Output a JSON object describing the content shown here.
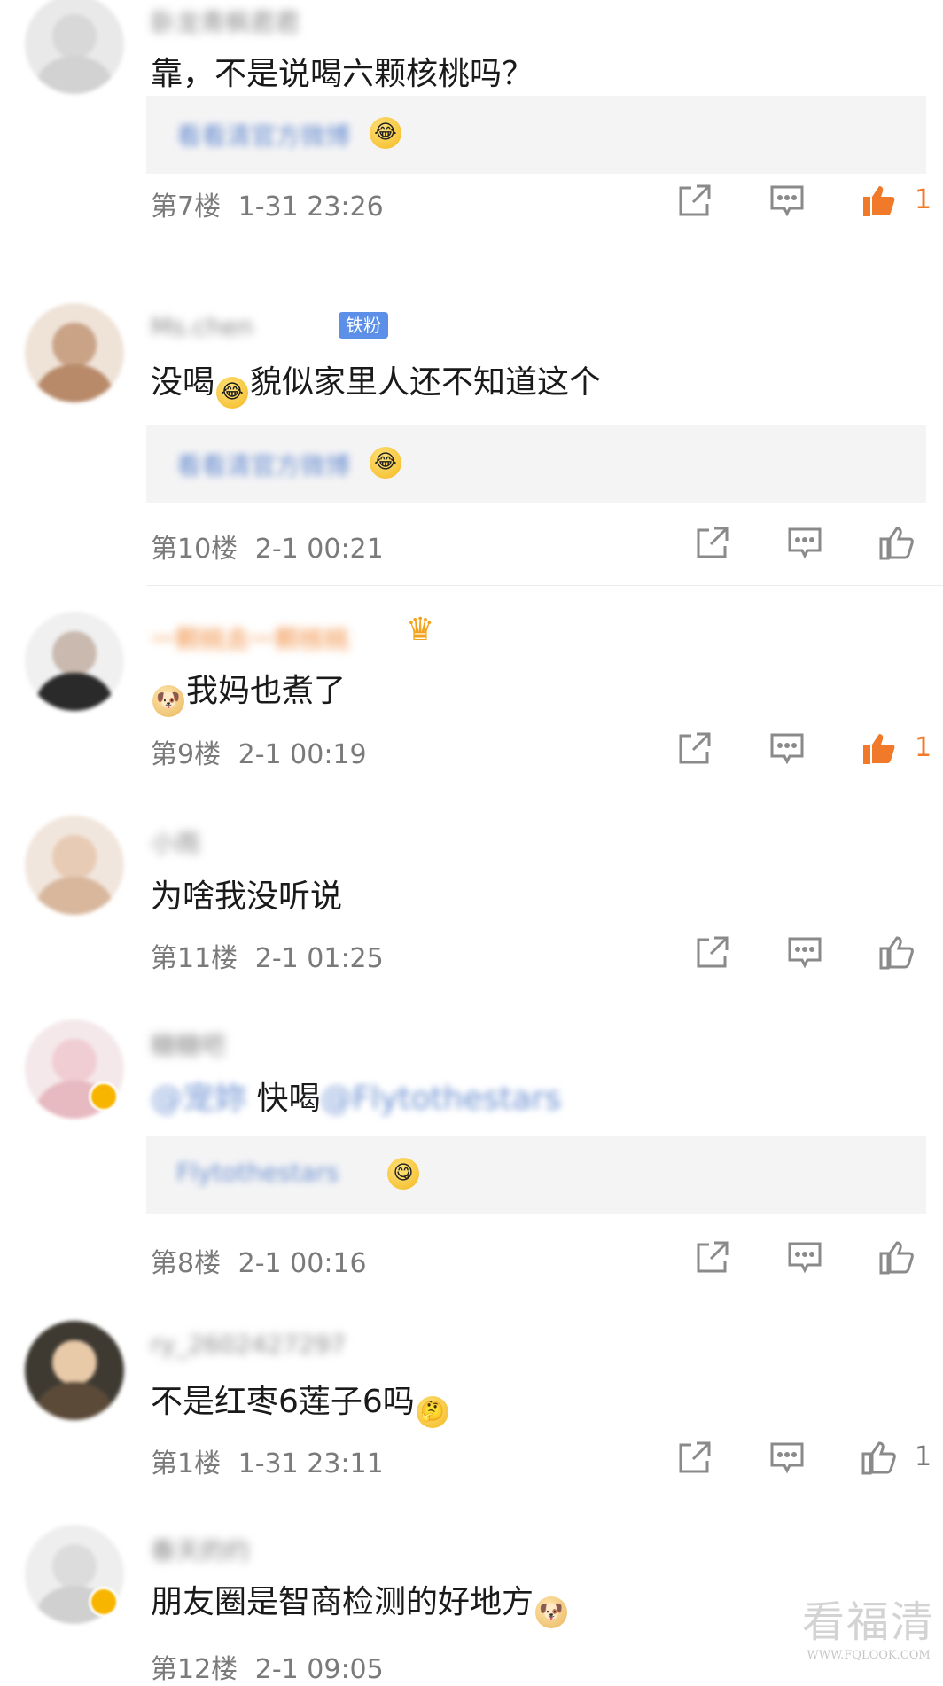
{
  "comments": [
    {
      "username": "卧龙青枫君君",
      "text": "靠，不是说喝六颗核桃吗？",
      "reply": {
        "name": "看看清官方微博",
        "emoji": "laugh-cry-emoji"
      },
      "floor": "第7楼",
      "time": "1-31 23:26",
      "likes": "1",
      "liked": true
    },
    {
      "username": "Ms.chen",
      "tag": "铁粉",
      "text_parts": [
        "没喝",
        "貌似家里人还不知道这个"
      ],
      "reply": {
        "name": "看看清官方微博",
        "emoji": "laugh-cry-emoji"
      },
      "floor": "第10楼",
      "time": "2-1 00:21",
      "likes": "",
      "liked": false
    },
    {
      "username": "一颗桃去一颗核桃",
      "text": "我妈也煮了",
      "floor": "第9楼",
      "time": "2-1 00:19",
      "likes": "1",
      "liked": true
    },
    {
      "username": "小雨",
      "text": "为啥我没听说",
      "floor": "第11楼",
      "time": "2-1 01:25",
      "likes": "",
      "liked": false
    },
    {
      "username": "糖糖吧",
      "mention_pre": "@宠妳",
      "text": "快喝",
      "mention_post": "@Flytothestars",
      "reply": {
        "name": "Flytothestars",
        "emoji": "yum-emoji"
      },
      "floor": "第8楼",
      "time": "2-1 00:16",
      "likes": "",
      "liked": false
    },
    {
      "username": "ry_2602427297",
      "text": "不是红枣6莲子6吗",
      "floor": "第1楼",
      "time": "1-31 23:11",
      "likes": "1",
      "liked": false
    },
    {
      "username": "春天的约",
      "text": "朋友圈是智商检测的好地方",
      "floor": "第12楼",
      "time": "2-1 09:05",
      "likes": "",
      "liked": false
    }
  ],
  "watermark": {
    "main": "看福清",
    "url": "WWW.FQLOOK.COM"
  },
  "colors": {
    "liked": "#f07a2a",
    "icon": "#8a8a8a",
    "tag": "#5b8fe8",
    "reply_bg": "#f4f4f5"
  }
}
